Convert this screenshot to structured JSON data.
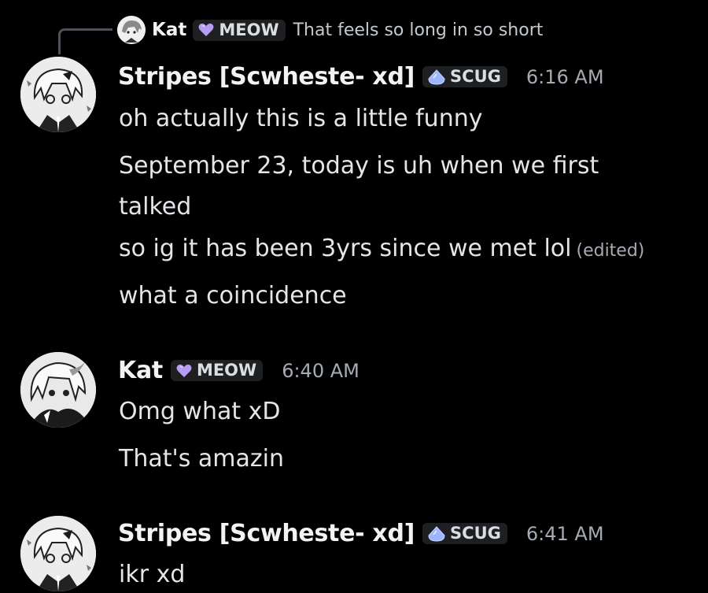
{
  "reply": {
    "author": "Kat",
    "tag": "MEOW",
    "text": "That feels so long in so short"
  },
  "messages": [
    {
      "author": "Stripes [Scwheste- xd]",
      "tag": "SCUG",
      "time": "6:16 AM",
      "lines": [
        "oh actually this is a little funny",
        "September 23, today is uh when we first",
        "talked",
        "so ig it has been 3yrs since we met lol",
        "what a coincidence"
      ],
      "edited": "(edited)"
    },
    {
      "author": "Kat",
      "tag": "MEOW",
      "time": "6:40 AM",
      "lines": [
        "Omg what xD",
        "That's amazin"
      ]
    },
    {
      "author": "Stripes [Scwheste- xd]",
      "tag": "SCUG",
      "time": "6:41 AM",
      "lines": [
        "ikr xd"
      ]
    }
  ],
  "colors": {
    "background": "#000000",
    "heart_tag": "#b69cf2",
    "drop_tag": "#9fb6ff"
  },
  "icons": {
    "meow_tag": "purple-heart-icon",
    "scug_tag": "blue-drop-icon"
  }
}
